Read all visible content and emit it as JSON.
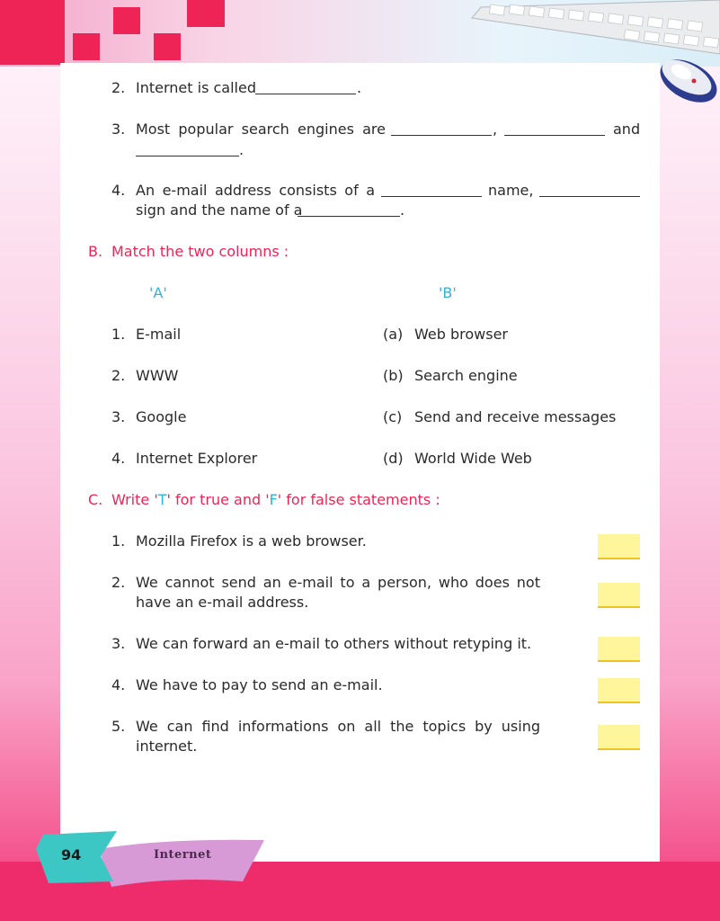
{
  "fill_blanks": {
    "q2": {
      "number": "2.",
      "text": "Internet is called",
      "end": "."
    },
    "q3": {
      "number": "3.",
      "text": "Most popular search engines are",
      "comma": ",",
      "and": "and",
      "end": "."
    },
    "q4": {
      "number": "4.",
      "text": "An e-mail address consists of a",
      "name": "name,",
      "line2": "sign and the name of a",
      "end": "."
    }
  },
  "section_b": {
    "letter": "B.",
    "heading": "Match the two columns :",
    "col_a": "'A'",
    "col_b": "'B'",
    "column_a": [
      {
        "number": "1.",
        "text": "E-mail"
      },
      {
        "number": "2.",
        "text": "WWW"
      },
      {
        "number": "3.",
        "text": "Google"
      },
      {
        "number": "4.",
        "text": "Internet Explorer"
      }
    ],
    "column_b": [
      {
        "letter": "(a)",
        "text": "Web browser"
      },
      {
        "letter": "(b)",
        "text": "Search engine"
      },
      {
        "letter": "(c)",
        "text": "Send and receive messages"
      },
      {
        "letter": "(d)",
        "text": "World Wide Web"
      }
    ]
  },
  "section_c": {
    "letter": "C.",
    "heading_1": "Write '",
    "t": "T",
    "heading_2": "' for true and '",
    "f": "F",
    "heading_3": "' for false statements :",
    "statements": [
      {
        "number": "1.",
        "line1": "Mozilla Firefox is a web browser."
      },
      {
        "number": "2.",
        "line1": "We cannot send an e-mail to a person, who does not",
        "line2": "have an e-mail address."
      },
      {
        "number": "3.",
        "line1": "We can forward an e-mail to others without retyping it."
      },
      {
        "number": "4.",
        "line1": "We have to pay to send an e-mail."
      },
      {
        "number": "5.",
        "line1": "We can find informations on all the topics by using",
        "line2": "internet."
      }
    ]
  },
  "footer": {
    "page_number": "94",
    "chapter": "Internet"
  },
  "colors": {
    "accent_red": "#ee2456",
    "accent_cyan": "#2fb3d6",
    "answer_box": "#fff59a",
    "tab_cyan": "#3cc6c4",
    "tab_purple": "#d79ad6"
  },
  "icons": [
    "keyboard-image",
    "mouse-image"
  ]
}
